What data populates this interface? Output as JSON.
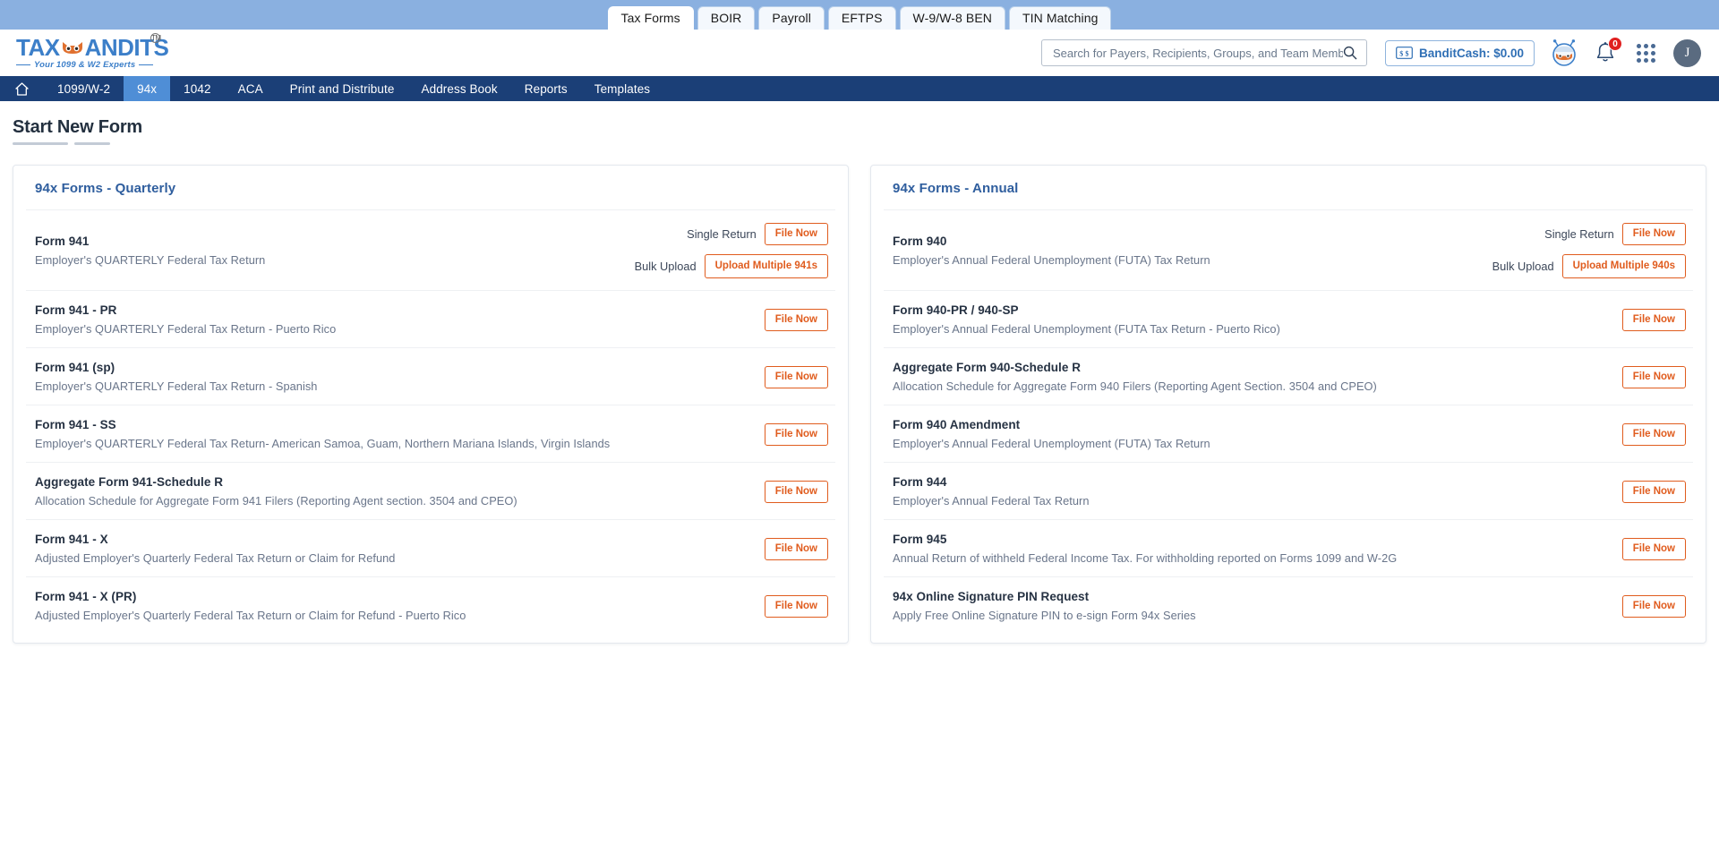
{
  "product_tabs": [
    {
      "label": "Tax Forms",
      "active": true
    },
    {
      "label": "BOIR",
      "active": false
    },
    {
      "label": "Payroll",
      "active": false
    },
    {
      "label": "EFTPS",
      "active": false
    },
    {
      "label": "W-9/W-8 BEN",
      "active": false
    },
    {
      "label": "TIN Matching",
      "active": false
    }
  ],
  "brand": {
    "name_part1": "TAX",
    "name_part2": "ANDITS",
    "trademark": "TM",
    "tagline": "Your 1099 & W2 Experts",
    "color": "#3c7fc9"
  },
  "search": {
    "placeholder": "Search for Payers, Recipients, Groups, and Team Members",
    "value": ""
  },
  "header": {
    "bandit_cash_label": "BanditCash: $0.00",
    "notification_count": "0",
    "avatar_initial": "J"
  },
  "nav": [
    {
      "label": "",
      "icon": "home-icon",
      "active": false,
      "name": "home"
    },
    {
      "label": "1099/W-2",
      "active": false,
      "name": "1099-w2"
    },
    {
      "label": "94x",
      "active": true,
      "name": "94x"
    },
    {
      "label": "1042",
      "active": false,
      "name": "1042"
    },
    {
      "label": "ACA",
      "active": false,
      "name": "aca"
    },
    {
      "label": "Print and Distribute",
      "active": false,
      "name": "print-and-distribute"
    },
    {
      "label": "Address Book",
      "active": false,
      "name": "address-book"
    },
    {
      "label": "Reports",
      "active": false,
      "name": "reports"
    },
    {
      "label": "Templates",
      "active": false,
      "name": "templates"
    }
  ],
  "page": {
    "title": "Start New Form"
  },
  "labels": {
    "single_return": "Single Return",
    "bulk_upload": "Bulk Upload",
    "file_now": "File Now"
  },
  "colors": {
    "accent_orange": "#e05c1e",
    "card_title_blue": "#2f5e9e",
    "nav_blue": "#1b3f77",
    "nav_active_blue": "#4f8ed6",
    "top_strip_blue": "#8ab0e0"
  },
  "quarterly": {
    "title": "94x Forms - Quarterly",
    "rows": [
      {
        "name": "Form 941",
        "desc": "Employer's QUARTERLY Federal Tax Return",
        "single_label": "Single Return",
        "single_btn": "File Now",
        "bulk_label": "Bulk Upload",
        "bulk_btn": "Upload Multiple 941s"
      },
      {
        "name": "Form 941 - PR",
        "desc": "Employer's QUARTERLY Federal Tax Return - Puerto Rico",
        "single_btn": "File Now"
      },
      {
        "name": "Form 941 (sp)",
        "desc": "Employer's QUARTERLY Federal Tax Return - Spanish",
        "single_btn": "File Now"
      },
      {
        "name": "Form 941 - SS",
        "desc": "Employer's QUARTERLY Federal Tax Return- American Samoa, Guam, Northern Mariana Islands, Virgin Islands",
        "single_btn": "File Now"
      },
      {
        "name": "Aggregate Form 941-Schedule R",
        "desc": "Allocation Schedule for Aggregate Form 941 Filers (Reporting Agent section. 3504 and CPEO)",
        "single_btn": "File Now"
      },
      {
        "name": "Form 941 - X",
        "desc": "Adjusted Employer's Quarterly Federal Tax Return or Claim for Refund",
        "single_btn": "File Now"
      },
      {
        "name": "Form 941 - X (PR)",
        "desc": "Adjusted Employer's Quarterly Federal Tax Return or Claim for Refund - Puerto Rico",
        "single_btn": "File Now"
      }
    ]
  },
  "annual": {
    "title": "94x Forms - Annual",
    "rows": [
      {
        "name": "Form 940",
        "desc": "Employer's Annual Federal Unemployment (FUTA) Tax Return",
        "single_label": "Single Return",
        "single_btn": "File Now",
        "bulk_label": "Bulk Upload",
        "bulk_btn": "Upload Multiple 940s"
      },
      {
        "name": "Form 940-PR / 940-SP",
        "desc": "Employer's Annual Federal Unemployment (FUTA Tax Return - Puerto Rico)",
        "single_btn": "File Now"
      },
      {
        "name": "Aggregate Form 940-Schedule R",
        "desc": "Allocation Schedule for Aggregate Form 940 Filers (Reporting Agent Section. 3504 and CPEO)",
        "single_btn": "File Now"
      },
      {
        "name": "Form 940 Amendment",
        "desc": "Employer's Annual Federal Unemployment (FUTA) Tax Return",
        "single_btn": "File Now"
      },
      {
        "name": "Form 944",
        "desc": "Employer's Annual Federal Tax Return",
        "single_btn": "File Now"
      },
      {
        "name": "Form 945",
        "desc": "Annual Return of withheld Federal Income Tax. For withholding reported on Forms 1099 and W-2G",
        "single_btn": "File Now"
      },
      {
        "name": "94x Online Signature PIN Request",
        "desc": "Apply Free Online Signature PIN to e-sign Form 94x Series",
        "single_btn": "File Now"
      }
    ]
  }
}
